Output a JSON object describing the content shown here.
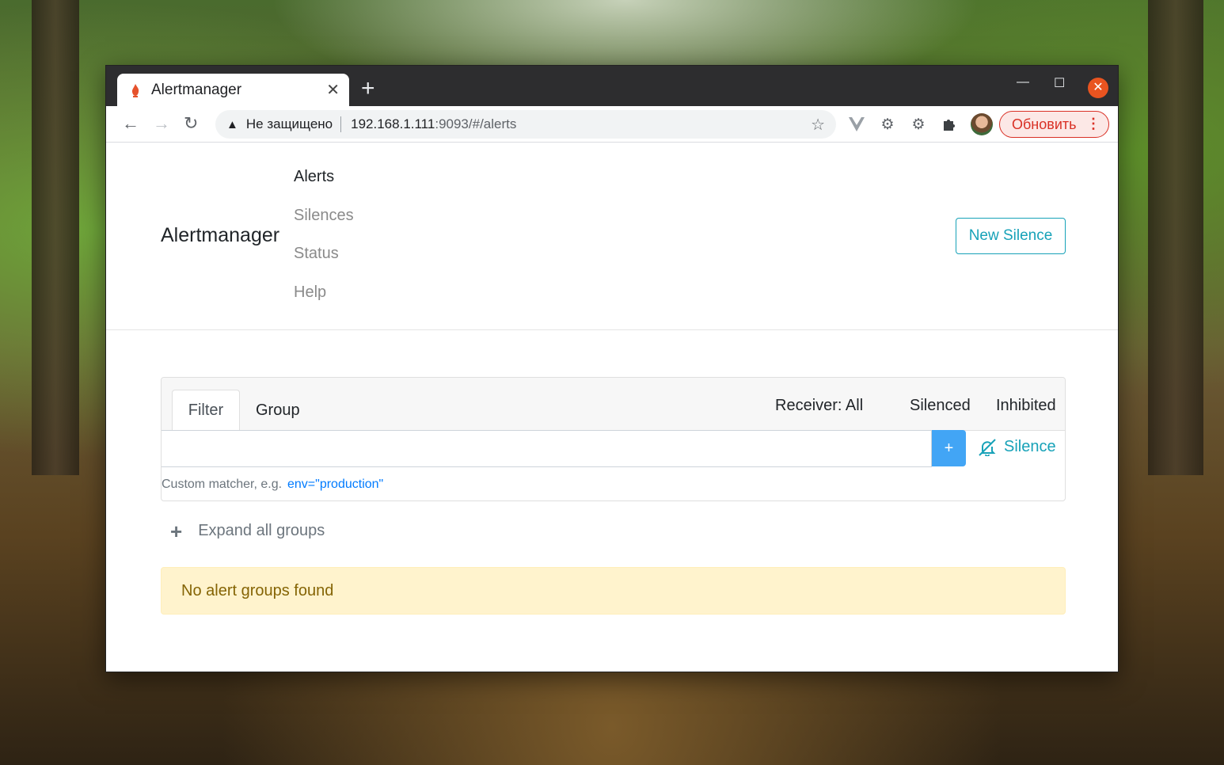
{
  "browser": {
    "tab_title": "Alertmanager",
    "tab_close": "✕",
    "new_tab": "+",
    "minimize": "—",
    "maximize": "☐",
    "close": "✕",
    "omnibox": {
      "security_text": "Не защищено",
      "url_host": "192.168.1.111",
      "url_path": ":9093/#/alerts"
    },
    "update_button": "Обновить",
    "icons": [
      "back-arrow-icon",
      "forward-arrow-icon",
      "reload-icon",
      "warning-icon",
      "star-icon",
      "vue-devtools-icon",
      "extension-gear-icon",
      "settings-gear-icon",
      "puzzle-icon",
      "avatar",
      "more-vert-icon"
    ]
  },
  "navbar": {
    "brand": "Alertmanager",
    "links": [
      "Alerts",
      "Silences",
      "Status",
      "Help"
    ],
    "active_link": "Alerts",
    "new_silence": "New Silence"
  },
  "filter_card": {
    "tabs": [
      "Filter",
      "Group"
    ],
    "receiver": "Receiver: All",
    "silenced": "Silenced",
    "inhibited": "Inhibited",
    "input_value": "",
    "add_button": "+",
    "silence_link": "Silence",
    "hint": "Custom matcher, e.g.",
    "hint_example": "env=\"production\""
  },
  "expand_all": "Expand all groups",
  "empty_message": "No alert groups found",
  "colors": {
    "accent": "#17a2b8",
    "primary_button": "#42a5f5",
    "warning_bg": "#fff3cd",
    "warning_text": "#856404",
    "chrome_update": "#d93025"
  }
}
